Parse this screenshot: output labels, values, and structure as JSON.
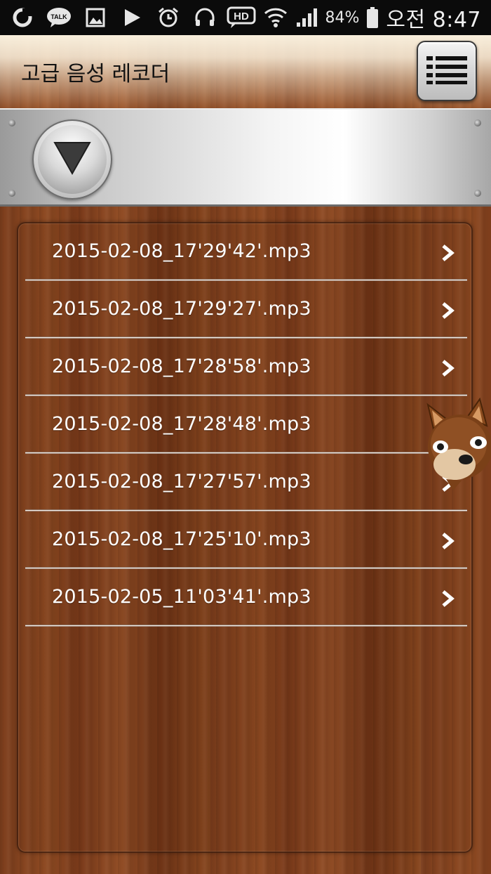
{
  "status_bar": {
    "left_icons": [
      "g-circle-icon",
      "kakaotalk-icon",
      "gallery-icon",
      "play-icon",
      "alarm-icon",
      "headset-icon"
    ],
    "kakao_label": "TALK",
    "hd_label": "HD",
    "battery_percent": "84%",
    "time": "오전 8:47"
  },
  "header": {
    "title": "고급 음성 레코더",
    "menu_icon": "list-menu-icon"
  },
  "toolbar": {
    "dropdown_icon": "triangle-down-icon"
  },
  "files": [
    {
      "name": "2015-02-08_17'29'42'.mp3"
    },
    {
      "name": "2015-02-08_17'29'27'.mp3"
    },
    {
      "name": "2015-02-08_17'28'58'.mp3"
    },
    {
      "name": "2015-02-08_17'28'48'.mp3"
    },
    {
      "name": "2015-02-08_17'27'57'.mp3"
    },
    {
      "name": "2015-02-08_17'25'10'.mp3"
    },
    {
      "name": "2015-02-05_11'03'41'.mp3"
    }
  ],
  "colors": {
    "wood": "#7e3f1c",
    "text": "#ffffff",
    "status_bg": "#0b0b0b"
  }
}
